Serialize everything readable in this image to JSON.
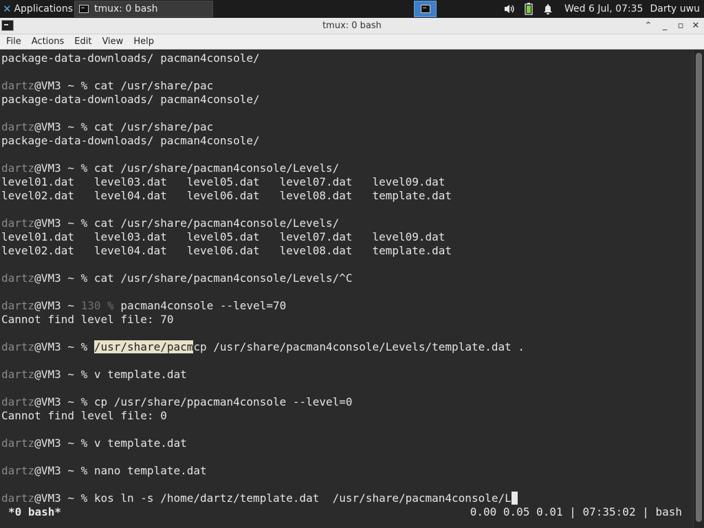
{
  "panel": {
    "applications_label": "Applications",
    "task_label": "tmux: 0 bash",
    "clock": "Wed  6 Jul, 07:35",
    "user": "Darty uwu"
  },
  "window": {
    "title": "tmux: 0 bash"
  },
  "menu": [
    "File",
    "Actions",
    "Edit",
    "View",
    "Help"
  ],
  "terminal": {
    "lines": [
      [
        {
          "t": "package-data-downloads/ pacman4console/"
        }
      ],
      [
        {
          "t": ""
        }
      ],
      [
        {
          "t": "dartz",
          "c": "usr"
        },
        {
          "t": "@VM3 ~ % cat /usr/share/pac"
        }
      ],
      [
        {
          "t": "package-data-downloads/ pacman4console/"
        }
      ],
      [
        {
          "t": ""
        }
      ],
      [
        {
          "t": "dartz",
          "c": "usr"
        },
        {
          "t": "@VM3 ~ % cat /usr/share/pac"
        }
      ],
      [
        {
          "t": "package-data-downloads/ pacman4console/"
        }
      ],
      [
        {
          "t": ""
        }
      ],
      [
        {
          "t": "dartz",
          "c": "usr"
        },
        {
          "t": "@VM3 ~ % cat /usr/share/pacman4console/Levels/"
        }
      ],
      [
        {
          "t": "level01.dat   level03.dat   level05.dat   level07.dat   level09.dat"
        }
      ],
      [
        {
          "t": "level02.dat   level04.dat   level06.dat   level08.dat   template.dat"
        }
      ],
      [
        {
          "t": ""
        }
      ],
      [
        {
          "t": "dartz",
          "c": "usr"
        },
        {
          "t": "@VM3 ~ % cat /usr/share/pacman4console/Levels/"
        }
      ],
      [
        {
          "t": "level01.dat   level03.dat   level05.dat   level07.dat   level09.dat"
        }
      ],
      [
        {
          "t": "level02.dat   level04.dat   level06.dat   level08.dat   template.dat"
        }
      ],
      [
        {
          "t": ""
        }
      ],
      [
        {
          "t": "dartz",
          "c": "usr"
        },
        {
          "t": "@VM3 ~ % cat /usr/share/pacman4console/Levels/^C"
        }
      ],
      [
        {
          "t": ""
        }
      ],
      [
        {
          "t": "dartz",
          "c": "usr"
        },
        {
          "t": "@VM3 ~ "
        },
        {
          "t": "130 %",
          "c": "dim"
        },
        {
          "t": " pacman4console --level=70"
        }
      ],
      [
        {
          "t": "Cannot find level file: 70"
        }
      ],
      [
        {
          "t": ""
        }
      ],
      [
        {
          "t": "dartz",
          "c": "usr"
        },
        {
          "t": "@VM3 ~ % "
        },
        {
          "t": "/usr/share/pacm",
          "c": "sel"
        },
        {
          "t": "cp /usr/share/pacman4console/Levels/template.dat ."
        }
      ],
      [
        {
          "t": ""
        }
      ],
      [
        {
          "t": "dartz",
          "c": "usr"
        },
        {
          "t": "@VM3 ~ % v template.dat"
        }
      ],
      [
        {
          "t": ""
        }
      ],
      [
        {
          "t": "dartz",
          "c": "usr"
        },
        {
          "t": "@VM3 ~ % cp /usr/share/ppacman4console --level=0"
        }
      ],
      [
        {
          "t": "Cannot find level file: 0"
        }
      ],
      [
        {
          "t": ""
        }
      ],
      [
        {
          "t": "dartz",
          "c": "usr"
        },
        {
          "t": "@VM3 ~ % v template.dat"
        }
      ],
      [
        {
          "t": ""
        }
      ],
      [
        {
          "t": "dartz",
          "c": "usr"
        },
        {
          "t": "@VM3 ~ % nano template.dat"
        }
      ],
      [
        {
          "t": ""
        }
      ],
      [
        {
          "t": "dartz",
          "c": "usr"
        },
        {
          "t": "@VM3 ~ % kos ln -s /home/dartz/template.dat  /usr/share/pacman4console/L"
        },
        {
          "t": " ",
          "c": "cursor"
        }
      ]
    ]
  },
  "tmux_status": {
    "left": "*0 bash*",
    "right": "0.00 0.05 0.01 | 07:35:02 | bash"
  }
}
